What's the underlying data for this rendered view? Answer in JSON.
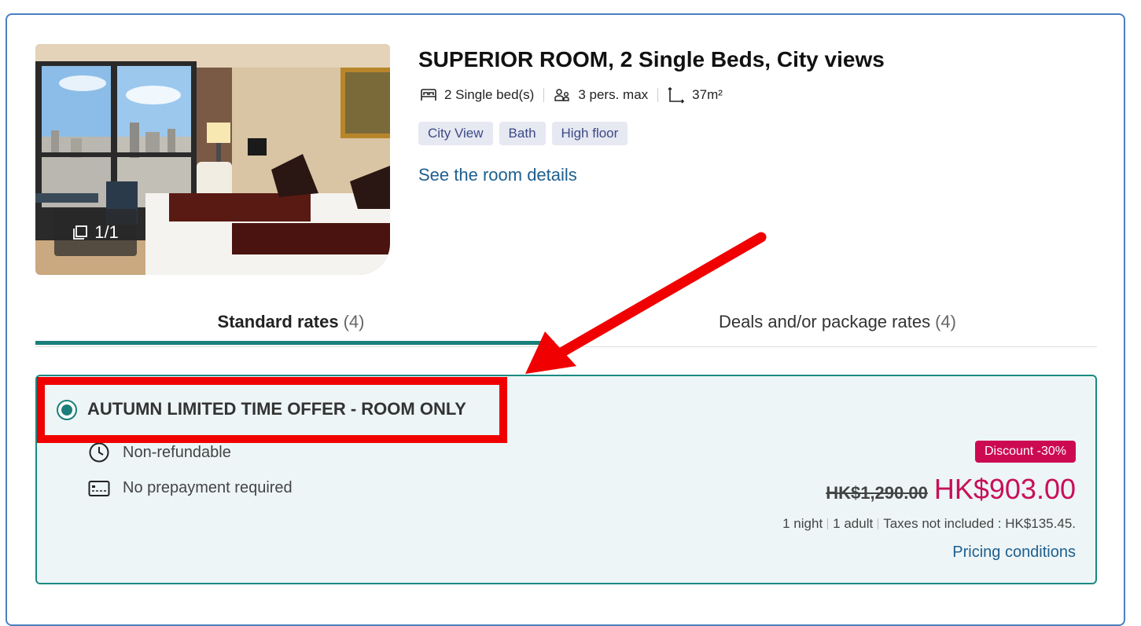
{
  "room": {
    "title": "SUPERIOR ROOM, 2 Single Beds, City views",
    "photo_counter": "1/1",
    "facts": {
      "beds": "2 Single bed(s)",
      "occupancy": "3 pers. max",
      "size": "37m²"
    },
    "tags": [
      "City View",
      "Bath",
      "High floor"
    ],
    "details_link": "See the room details"
  },
  "tabs": [
    {
      "label": "Standard rates",
      "count": "(4)",
      "active": true
    },
    {
      "label": "Deals and/or package rates",
      "count": "(4)",
      "active": false
    }
  ],
  "rate": {
    "name": "AUTUMN LIMITED TIME OFFER - ROOM ONLY",
    "selected": true,
    "conditions": [
      "Non-refundable",
      "No prepayment required"
    ],
    "discount": "Discount -30%",
    "old_price": "HK$1,290.00",
    "price": "HK$903.00",
    "nights": "1 night",
    "guests": "1 adult",
    "taxes": "Taxes not included : HK$135.45.",
    "pricing_link": "Pricing conditions"
  },
  "annotation": {
    "highlight_color": "#f00000",
    "arrow_color": "#f00000"
  },
  "colors": {
    "accent": "#1a7f7a",
    "price": "#c8105a",
    "link": "#1e5f8e",
    "badge": "#cc0a52"
  }
}
